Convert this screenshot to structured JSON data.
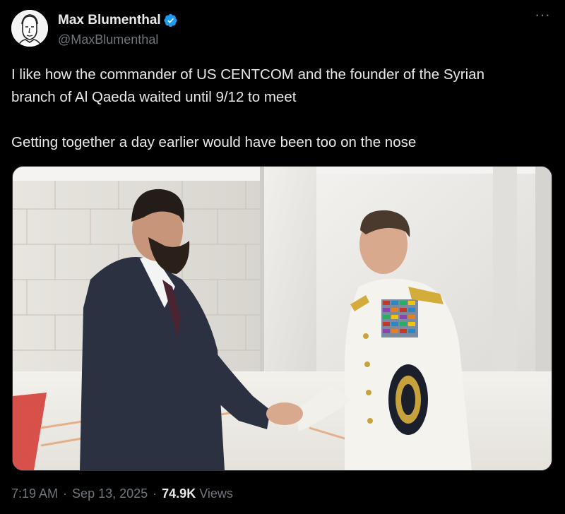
{
  "author": {
    "name": "Max Blumenthal",
    "handle": "@MaxBlumenthal",
    "verified_color": "#1d9bf0"
  },
  "more_label": "···",
  "tweet": {
    "line1": "I like how the commander of US CENTCOM and the founder of the Syrian",
    "line2": "branch of Al Qaeda waited until 9/12 to meet",
    "line3": "Getting together a day earlier would have been too on the nose"
  },
  "meta": {
    "time": "7:19 AM",
    "date": "Sep 13, 2025",
    "views_count": "74.9K",
    "views_label": "Views",
    "separator": "·"
  },
  "colors": {
    "background": "#000000",
    "text": "#e7e9ea",
    "secondary": "#71767b",
    "accent": "#1d9bf0"
  }
}
